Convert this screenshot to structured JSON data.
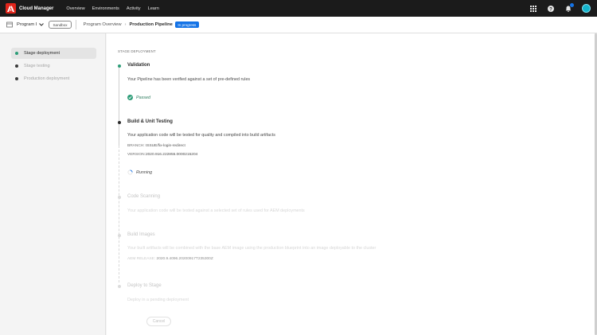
{
  "topbar": {
    "app_title": "Cloud Manager",
    "nav": [
      "Overview",
      "Environments",
      "Activity",
      "Learn"
    ],
    "icons": [
      "apps-grid-icon",
      "help-icon",
      "notifications-bell-icon",
      "user-avatar"
    ]
  },
  "subheader": {
    "program_name": "Program I",
    "sandbox_label": "Sandbox",
    "breadcrumb_link": "Program Overview",
    "breadcrumb_sep": "›",
    "breadcrumb_current": "Production Pipeline",
    "status_badge": "In progress"
  },
  "sidebar": {
    "items": [
      {
        "label": "Stage deployment",
        "active": true
      },
      {
        "label": "Stage testing",
        "active": false
      },
      {
        "label": "Production deployment",
        "active": false
      }
    ]
  },
  "main": {
    "section_label": "STAGE DEPLOYMENT",
    "steps": {
      "validation": {
        "title": "Validation",
        "text": "Your Pipeline has been verified against a set of pre-defined rules",
        "status": "Passed"
      },
      "build": {
        "title": "Build & Unit Testing",
        "text": "Your application code will be tested for quality and compiled into build artifacts",
        "branch_label": "BRANCH:",
        "branch_value": "ISSUE/fix-login-redirect",
        "version_label": "VERSION:",
        "version_value": "2020.916.222855.0000215204",
        "status": "Running"
      },
      "code_scanning": {
        "title": "Code Scanning",
        "text": "Your application code will be tested against a selected set of rules used for AEM deployments"
      },
      "build_images": {
        "title": "Build Images",
        "text": "Your built artifacts will be combined with the base AEM image using the production blueprint into an image deployable to the cluster",
        "aem_label": "AEM RELEASE:",
        "aem_value": "2020.9.4096.20200917T235300Z"
      },
      "deploy": {
        "title": "Deploy to Stage",
        "text": "Deploy in a pending deployment"
      }
    },
    "cancel_label": "Cancel"
  },
  "colors": {
    "topbar_bg": "#1b1b1b",
    "brand_red": "#e1251b",
    "accent_blue": "#1473e6",
    "success_green": "#2d9d78"
  }
}
